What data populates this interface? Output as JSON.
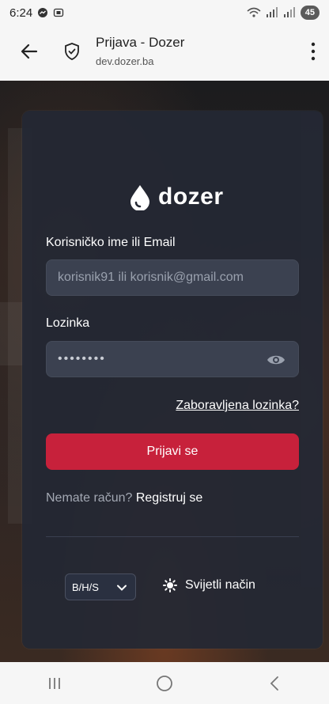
{
  "status_bar": {
    "time": "6:24",
    "battery": "45"
  },
  "browser": {
    "title": "Prijava - Dozer",
    "url": "dev.dozer.ba"
  },
  "login": {
    "brand": "dozer",
    "username_label": "Korisničko ime ili Email",
    "username_placeholder": "korisnik91 ili korisnik@gmail.com",
    "password_label": "Lozinka",
    "password_value": "••••••••",
    "forgot_password": "Zaboravljena lozinka?",
    "submit": "Prijavi se",
    "no_account": "Nemate račun?",
    "register": "Registruj se"
  },
  "footer": {
    "language": "B/H/S",
    "theme_toggle": "Svijetli način"
  },
  "colors": {
    "card": "#242834",
    "input": "#3b4150",
    "primary": "#c7213b"
  },
  "icons": [
    "back-arrow-icon",
    "shield-check-icon",
    "more-vert-icon",
    "water-drop-icon",
    "eye-icon",
    "chevron-down-icon",
    "sun-icon",
    "recent-apps-icon",
    "home-icon",
    "back-icon"
  ]
}
